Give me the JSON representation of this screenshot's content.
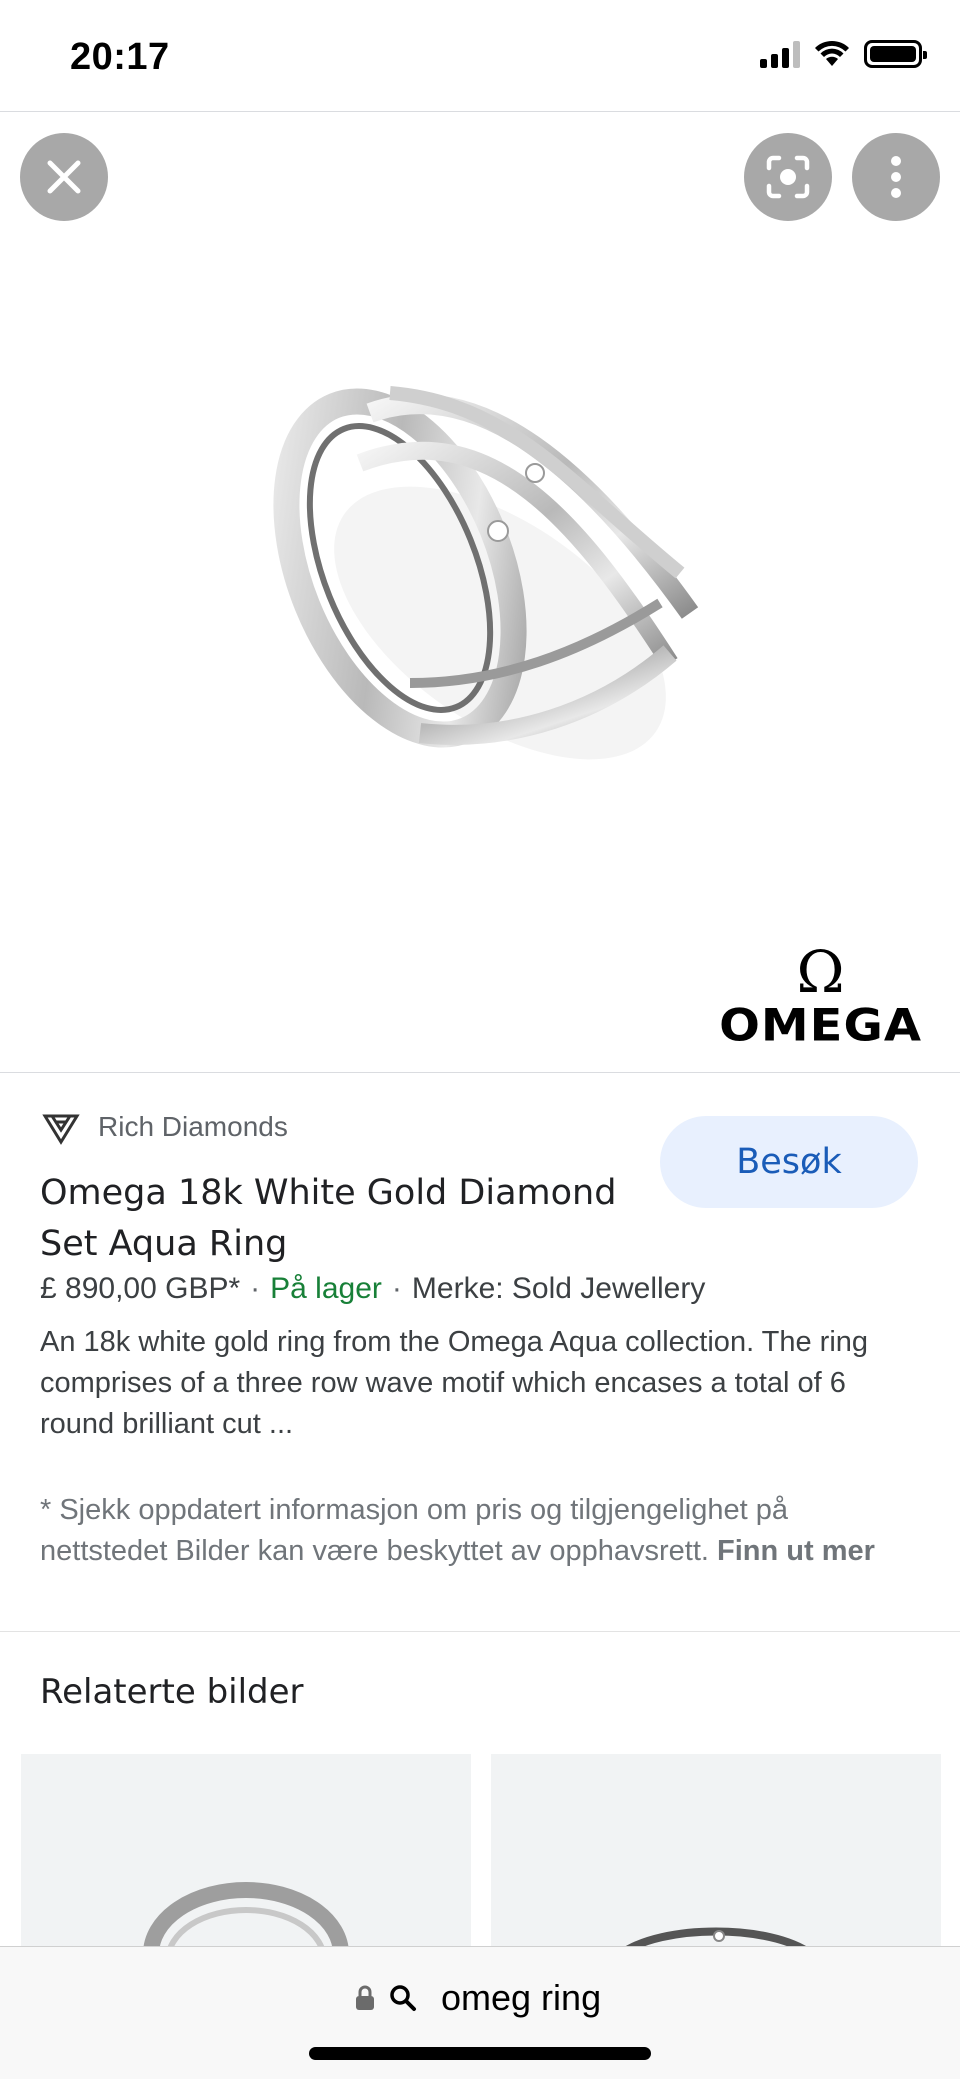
{
  "status_bar": {
    "time": "20:17"
  },
  "hero": {
    "close_icon": "close-icon",
    "lens_icon": "lens-icon",
    "more_icon": "more-vert-icon",
    "brand_logo_symbol": "Ω",
    "brand_logo_text": "OMEGA"
  },
  "product": {
    "source_name": "Rich Diamonds",
    "visit_label": "Besøk",
    "title": "Omega 18k White Gold Diamond Set Aqua Ring",
    "price": "£ 890,00 GBP*",
    "stock": "På lager",
    "brand": "Merke: Sold Jewellery",
    "description": "An 18k white gold ring from the Omega Aqua collection. The ring comprises of a three row wave motif which encases a total of 6 round brilliant cut ...",
    "note": "* Sjekk oppdatert informasjon om pris og tilgjengelighet på nettstedet Bilder kan være beskyttet av opphavsrett.",
    "note_link": "Finn ut mer"
  },
  "related": {
    "title": "Relaterte bilder"
  },
  "address_bar": {
    "query": "omeg ring"
  },
  "colors": {
    "visit_bg": "#e8f0fe",
    "visit_text": "#1a5cb8",
    "stock_green": "#188038",
    "hero_button": "#a8a8a8"
  }
}
